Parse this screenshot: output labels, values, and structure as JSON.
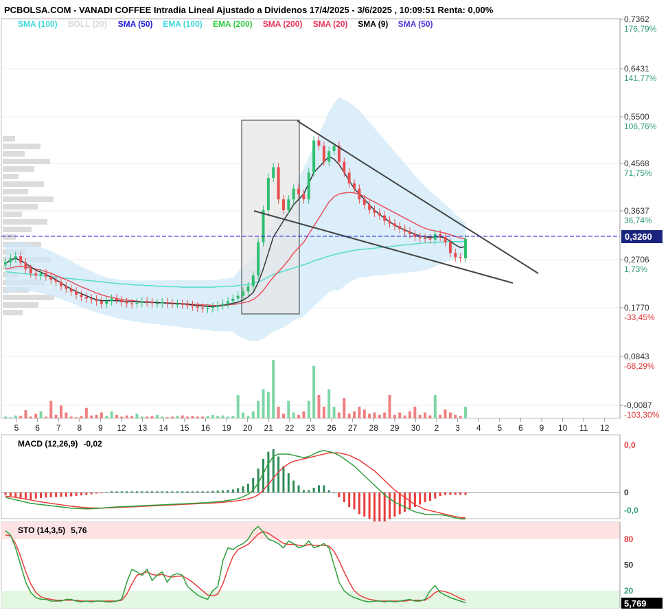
{
  "header": {
    "title": "PCBOLSA.COM - VANADI COFFEE Intradia Lineal Ajustado a Dividenos 17/4/2025 - 3/6/2025 , 10:09:51 Renta: 0,00%"
  },
  "legend": [
    {
      "label": "SMA (100)",
      "color": "#3fd8d8"
    },
    {
      "label": "BOLL (20)",
      "color": "#d9d9d9"
    },
    {
      "label": "SMA (50)",
      "color": "#1a1ad6"
    },
    {
      "label": "EMA (100)",
      "color": "#3fd8d8"
    },
    {
      "label": "EMA (200)",
      "color": "#2ecc40"
    },
    {
      "label": "SMA (200)",
      "color": "#e8335a"
    },
    {
      "label": "SMA (20)",
      "color": "#e8335a"
    },
    {
      "label": "SMA (9)",
      "color": "#000000"
    },
    {
      "label": "SMA (50)",
      "color": "#4b3bd6"
    }
  ],
  "colors": {
    "up": "#2fbf71",
    "down": "#e84d4d",
    "sma9": "#333333",
    "sma20": "#e8505b",
    "sma100": "#55dccc",
    "boll": "#cfe8f8",
    "price_line": "#1a1ad6",
    "current_label_bg": "#1a237e"
  },
  "price_axis": [
    {
      "price": "0,7362",
      "pct": "176,79%",
      "tone": "g"
    },
    {
      "price": "0,6431",
      "pct": "141,77%",
      "tone": "g"
    },
    {
      "price": "0,5500",
      "pct": "106,76%",
      "tone": "g"
    },
    {
      "price": "0,4568",
      "pct": "71,75%",
      "tone": "g"
    },
    {
      "price": "0,3637",
      "pct": "36,74%",
      "tone": "g"
    },
    {
      "price": "0,2706",
      "pct": "1,73%",
      "tone": "g"
    },
    {
      "price": "0,1770",
      "pct": "-33,45%",
      "tone": "r"
    },
    {
      "price": "0,0843",
      "pct": "-68,29%",
      "tone": "r"
    },
    {
      "price": "-0,0087",
      "pct": "-103,30%",
      "tone": "r"
    }
  ],
  "current_price": "0,3260",
  "x_labels": [
    "5",
    "6",
    "7",
    "8",
    "9",
    "12",
    "13",
    "14",
    "15",
    "16",
    "19",
    "20",
    "21",
    "22",
    "23",
    "26",
    "27",
    "28",
    "29",
    "30",
    "2",
    "3",
    "4",
    "5",
    "6",
    "9",
    "10",
    "11",
    "12"
  ],
  "macd": {
    "label": "MACD (12,26,9)",
    "value": "-0,02",
    "axis": [
      "0,0",
      "0",
      "-0,0"
    ]
  },
  "sto": {
    "label": "STO (14,3,5)",
    "value": "5,76",
    "axis": [
      "80",
      "50",
      "20"
    ],
    "current": "5,769"
  },
  "chart_data": {
    "type": "candlestick",
    "title": "VANADI COFFEE Intradia Lineal Ajustado a Dividenos 17/4/2025 - 3/6/2025",
    "ylim": [
      -0.0087,
      0.7362
    ],
    "close": [
      0.283,
      0.29,
      0.294,
      0.282,
      0.27,
      0.262,
      0.258,
      0.262,
      0.256,
      0.25,
      0.246,
      0.238,
      0.233,
      0.228,
      0.222,
      0.218,
      0.215,
      0.213,
      0.21,
      0.205,
      0.21,
      0.215,
      0.212,
      0.208,
      0.206,
      0.205,
      0.207,
      0.21,
      0.208,
      0.206,
      0.206,
      0.208,
      0.206,
      0.205,
      0.205,
      0.204,
      0.203,
      0.2,
      0.198,
      0.196,
      0.197,
      0.199,
      0.202,
      0.205,
      0.21,
      0.215,
      0.22,
      0.228,
      0.238,
      0.258,
      0.32,
      0.38,
      0.44,
      0.46,
      0.4,
      0.38,
      0.4,
      0.42,
      0.41,
      0.4,
      0.45,
      0.51,
      0.5,
      0.47,
      0.49,
      0.5,
      0.47,
      0.45,
      0.43,
      0.42,
      0.4,
      0.39,
      0.38,
      0.375,
      0.37,
      0.36,
      0.355,
      0.35,
      0.345,
      0.34,
      0.335,
      0.33,
      0.328,
      0.327,
      0.325,
      0.335,
      0.33,
      0.32,
      0.3,
      0.292,
      0.29,
      0.326
    ],
    "ma_9": [
      0.28,
      0.287,
      0.29,
      0.286,
      0.28,
      0.274,
      0.268,
      0.264,
      0.26,
      0.255,
      0.25,
      0.244,
      0.238,
      0.233,
      0.228,
      0.224,
      0.22,
      0.216,
      0.213,
      0.211,
      0.211,
      0.211,
      0.211,
      0.21,
      0.209,
      0.209,
      0.209,
      0.208,
      0.208,
      0.208,
      0.207,
      0.207,
      0.206,
      0.206,
      0.205,
      0.205,
      0.204,
      0.203,
      0.202,
      0.201,
      0.2,
      0.2,
      0.201,
      0.202,
      0.204,
      0.206,
      0.208,
      0.212,
      0.218,
      0.226,
      0.245,
      0.27,
      0.3,
      0.33,
      0.345,
      0.36,
      0.375,
      0.39,
      0.4,
      0.41,
      0.43,
      0.45,
      0.46,
      0.47,
      0.48,
      0.475,
      0.465,
      0.45,
      0.435,
      0.42,
      0.41,
      0.4,
      0.39,
      0.38,
      0.372,
      0.365,
      0.358,
      0.352,
      0.347,
      0.343,
      0.339,
      0.335,
      0.332,
      0.33,
      0.329,
      0.33,
      0.33,
      0.328,
      0.322,
      0.315,
      0.31,
      0.312
    ],
    "ma_20": [
      0.27,
      0.272,
      0.274,
      0.275,
      0.274,
      0.272,
      0.27,
      0.268,
      0.265,
      0.262,
      0.258,
      0.254,
      0.25,
      0.246,
      0.241,
      0.237,
      0.233,
      0.229,
      0.225,
      0.222,
      0.219,
      0.217,
      0.215,
      0.213,
      0.212,
      0.211,
      0.21,
      0.209,
      0.209,
      0.208,
      0.208,
      0.207,
      0.207,
      0.206,
      0.206,
      0.205,
      0.205,
      0.204,
      0.204,
      0.203,
      0.203,
      0.202,
      0.202,
      0.203,
      0.203,
      0.204,
      0.205,
      0.207,
      0.209,
      0.213,
      0.22,
      0.23,
      0.243,
      0.255,
      0.265,
      0.275,
      0.287,
      0.3,
      0.31,
      0.32,
      0.335,
      0.35,
      0.365,
      0.38,
      0.395,
      0.405,
      0.41,
      0.412,
      0.413,
      0.412,
      0.41,
      0.405,
      0.4,
      0.395,
      0.39,
      0.385,
      0.38,
      0.375,
      0.37,
      0.365,
      0.36,
      0.355,
      0.35,
      0.346,
      0.343,
      0.341,
      0.339,
      0.337,
      0.334,
      0.331,
      0.328,
      0.326
    ],
    "ma_100": [
      0.265,
      0.264,
      0.263,
      0.262,
      0.261,
      0.26,
      0.259,
      0.258,
      0.257,
      0.256,
      0.255,
      0.254,
      0.253,
      0.252,
      0.251,
      0.25,
      0.249,
      0.248,
      0.247,
      0.246,
      0.245,
      0.244,
      0.243,
      0.242,
      0.242,
      0.241,
      0.24,
      0.24,
      0.239,
      0.239,
      0.238,
      0.238,
      0.237,
      0.237,
      0.237,
      0.236,
      0.236,
      0.236,
      0.236,
      0.236,
      0.236,
      0.236,
      0.237,
      0.237,
      0.238,
      0.238,
      0.239,
      0.24,
      0.241,
      0.243,
      0.246,
      0.25,
      0.255,
      0.26,
      0.263,
      0.266,
      0.269,
      0.272,
      0.275,
      0.278,
      0.281,
      0.285,
      0.288,
      0.291,
      0.294,
      0.297,
      0.299,
      0.301,
      0.303,
      0.305,
      0.306,
      0.307,
      0.308,
      0.309,
      0.31,
      0.311,
      0.312,
      0.313,
      0.314,
      0.315,
      0.316,
      0.317,
      0.318,
      0.319,
      0.319,
      0.32,
      0.32,
      0.321,
      0.321,
      0.321,
      0.321,
      0.322
    ],
    "volume_max": 100,
    "volume": [
      3,
      2,
      5,
      4,
      14,
      3,
      8,
      12,
      3,
      30,
      6,
      22,
      10,
      3,
      2,
      4,
      18,
      5,
      6,
      10,
      4,
      12,
      6,
      3,
      5,
      4,
      8,
      3,
      3,
      4,
      6,
      3,
      2,
      3,
      4,
      5,
      3,
      4,
      3,
      3,
      4,
      6,
      4,
      5,
      3,
      4,
      40,
      10,
      4,
      12,
      30,
      50,
      45,
      100,
      20,
      8,
      30,
      10,
      6,
      12,
      30,
      90,
      40,
      20,
      50,
      20,
      10,
      35,
      8,
      12,
      20,
      15,
      8,
      10,
      6,
      10,
      40,
      6,
      10,
      5,
      12,
      20,
      6,
      10,
      5,
      40,
      6,
      15,
      10,
      6,
      4,
      20
    ],
    "macd_line": [
      -0.004,
      -0.005,
      -0.006,
      -0.007,
      -0.008,
      -0.009,
      -0.0095,
      -0.01,
      -0.0105,
      -0.011,
      -0.0115,
      -0.012,
      -0.0125,
      -0.013,
      -0.0132,
      -0.0134,
      -0.0136,
      -0.0135,
      -0.0133,
      -0.013,
      -0.0126,
      -0.0122,
      -0.012,
      -0.0118,
      -0.0116,
      -0.0114,
      -0.0112,
      -0.011,
      -0.0108,
      -0.0106,
      -0.0104,
      -0.0102,
      -0.01,
      -0.0098,
      -0.0096,
      -0.0094,
      -0.0092,
      -0.009,
      -0.0088,
      -0.0086,
      -0.0084,
      -0.008,
      -0.0076,
      -0.0072,
      -0.0066,
      -0.006,
      -0.005,
      -0.0035,
      -0.0015,
      0.002,
      0.008,
      0.016,
      0.024,
      0.03,
      0.032,
      0.032,
      0.032,
      0.031,
      0.03,
      0.029,
      0.03,
      0.032,
      0.034,
      0.035,
      0.034,
      0.033,
      0.031,
      0.028,
      0.025,
      0.022,
      0.018,
      0.014,
      0.01,
      0.006,
      0.002,
      -0.002,
      -0.005,
      -0.008,
      -0.01,
      -0.012,
      -0.014,
      -0.016,
      -0.017,
      -0.018,
      -0.0185,
      -0.0185,
      -0.0185,
      -0.019,
      -0.02,
      -0.021,
      -0.022,
      -0.022
    ],
    "macd_signal": [
      -0.003,
      -0.0035,
      -0.004,
      -0.0048,
      -0.0055,
      -0.0062,
      -0.007,
      -0.0077,
      -0.0084,
      -0.009,
      -0.0096,
      -0.0102,
      -0.0108,
      -0.0114,
      -0.0118,
      -0.0122,
      -0.0126,
      -0.0128,
      -0.0129,
      -0.0129,
      -0.0128,
      -0.0127,
      -0.0125,
      -0.0123,
      -0.0121,
      -0.0119,
      -0.0117,
      -0.0115,
      -0.0113,
      -0.0111,
      -0.0109,
      -0.0107,
      -0.0105,
      -0.0103,
      -0.0101,
      -0.0099,
      -0.0097,
      -0.0095,
      -0.0093,
      -0.0091,
      -0.0089,
      -0.0087,
      -0.0084,
      -0.0081,
      -0.0077,
      -0.0073,
      -0.0068,
      -0.0061,
      -0.0052,
      -0.004,
      -0.002,
      0.002,
      0.007,
      0.012,
      0.017,
      0.021,
      0.024,
      0.026,
      0.027,
      0.028,
      0.029,
      0.03,
      0.031,
      0.032,
      0.033,
      0.033,
      0.033,
      0.032,
      0.031,
      0.029,
      0.027,
      0.024,
      0.021,
      0.018,
      0.014,
      0.01,
      0.006,
      0.002,
      -0.001,
      -0.004,
      -0.007,
      -0.01,
      -0.012,
      -0.014,
      -0.015,
      -0.016,
      -0.017,
      -0.018,
      -0.019,
      -0.02,
      -0.021,
      -0.021
    ],
    "sto_k": [
      90,
      85,
      70,
      50,
      30,
      18,
      12,
      10,
      10,
      8,
      8,
      8,
      10,
      10,
      8,
      7,
      8,
      7,
      8,
      8,
      7,
      7,
      8,
      10,
      30,
      45,
      42,
      38,
      45,
      32,
      38,
      42,
      30,
      38,
      40,
      38,
      25,
      20,
      15,
      12,
      10,
      20,
      25,
      55,
      70,
      68,
      72,
      75,
      80,
      90,
      95,
      88,
      80,
      78,
      75,
      70,
      78,
      75,
      70,
      72,
      78,
      70,
      72,
      75,
      70,
      50,
      30,
      20,
      15,
      12,
      10,
      8,
      7,
      8,
      8,
      7,
      8,
      7,
      8,
      9,
      10,
      8,
      8,
      10,
      20,
      26,
      18,
      15,
      12,
      10,
      8,
      6
    ],
    "sto_d": [
      85,
      84,
      75,
      60,
      42,
      28,
      18,
      13,
      11,
      10,
      9,
      9,
      9,
      9,
      9,
      8,
      8,
      8,
      8,
      8,
      8,
      8,
      8,
      9,
      16,
      28,
      38,
      40,
      42,
      39,
      38,
      39,
      37,
      36,
      37,
      37,
      34,
      30,
      25,
      20,
      15,
      14,
      16,
      28,
      45,
      60,
      68,
      71,
      74,
      80,
      86,
      89,
      87,
      83,
      79,
      75,
      74,
      74,
      73,
      72,
      74,
      73,
      73,
      73,
      72,
      66,
      55,
      42,
      30,
      20,
      15,
      12,
      10,
      9,
      8,
      8,
      8,
      8,
      8,
      8,
      9,
      9,
      9,
      9,
      13,
      18,
      20,
      19,
      17,
      14,
      11,
      9
    ]
  }
}
